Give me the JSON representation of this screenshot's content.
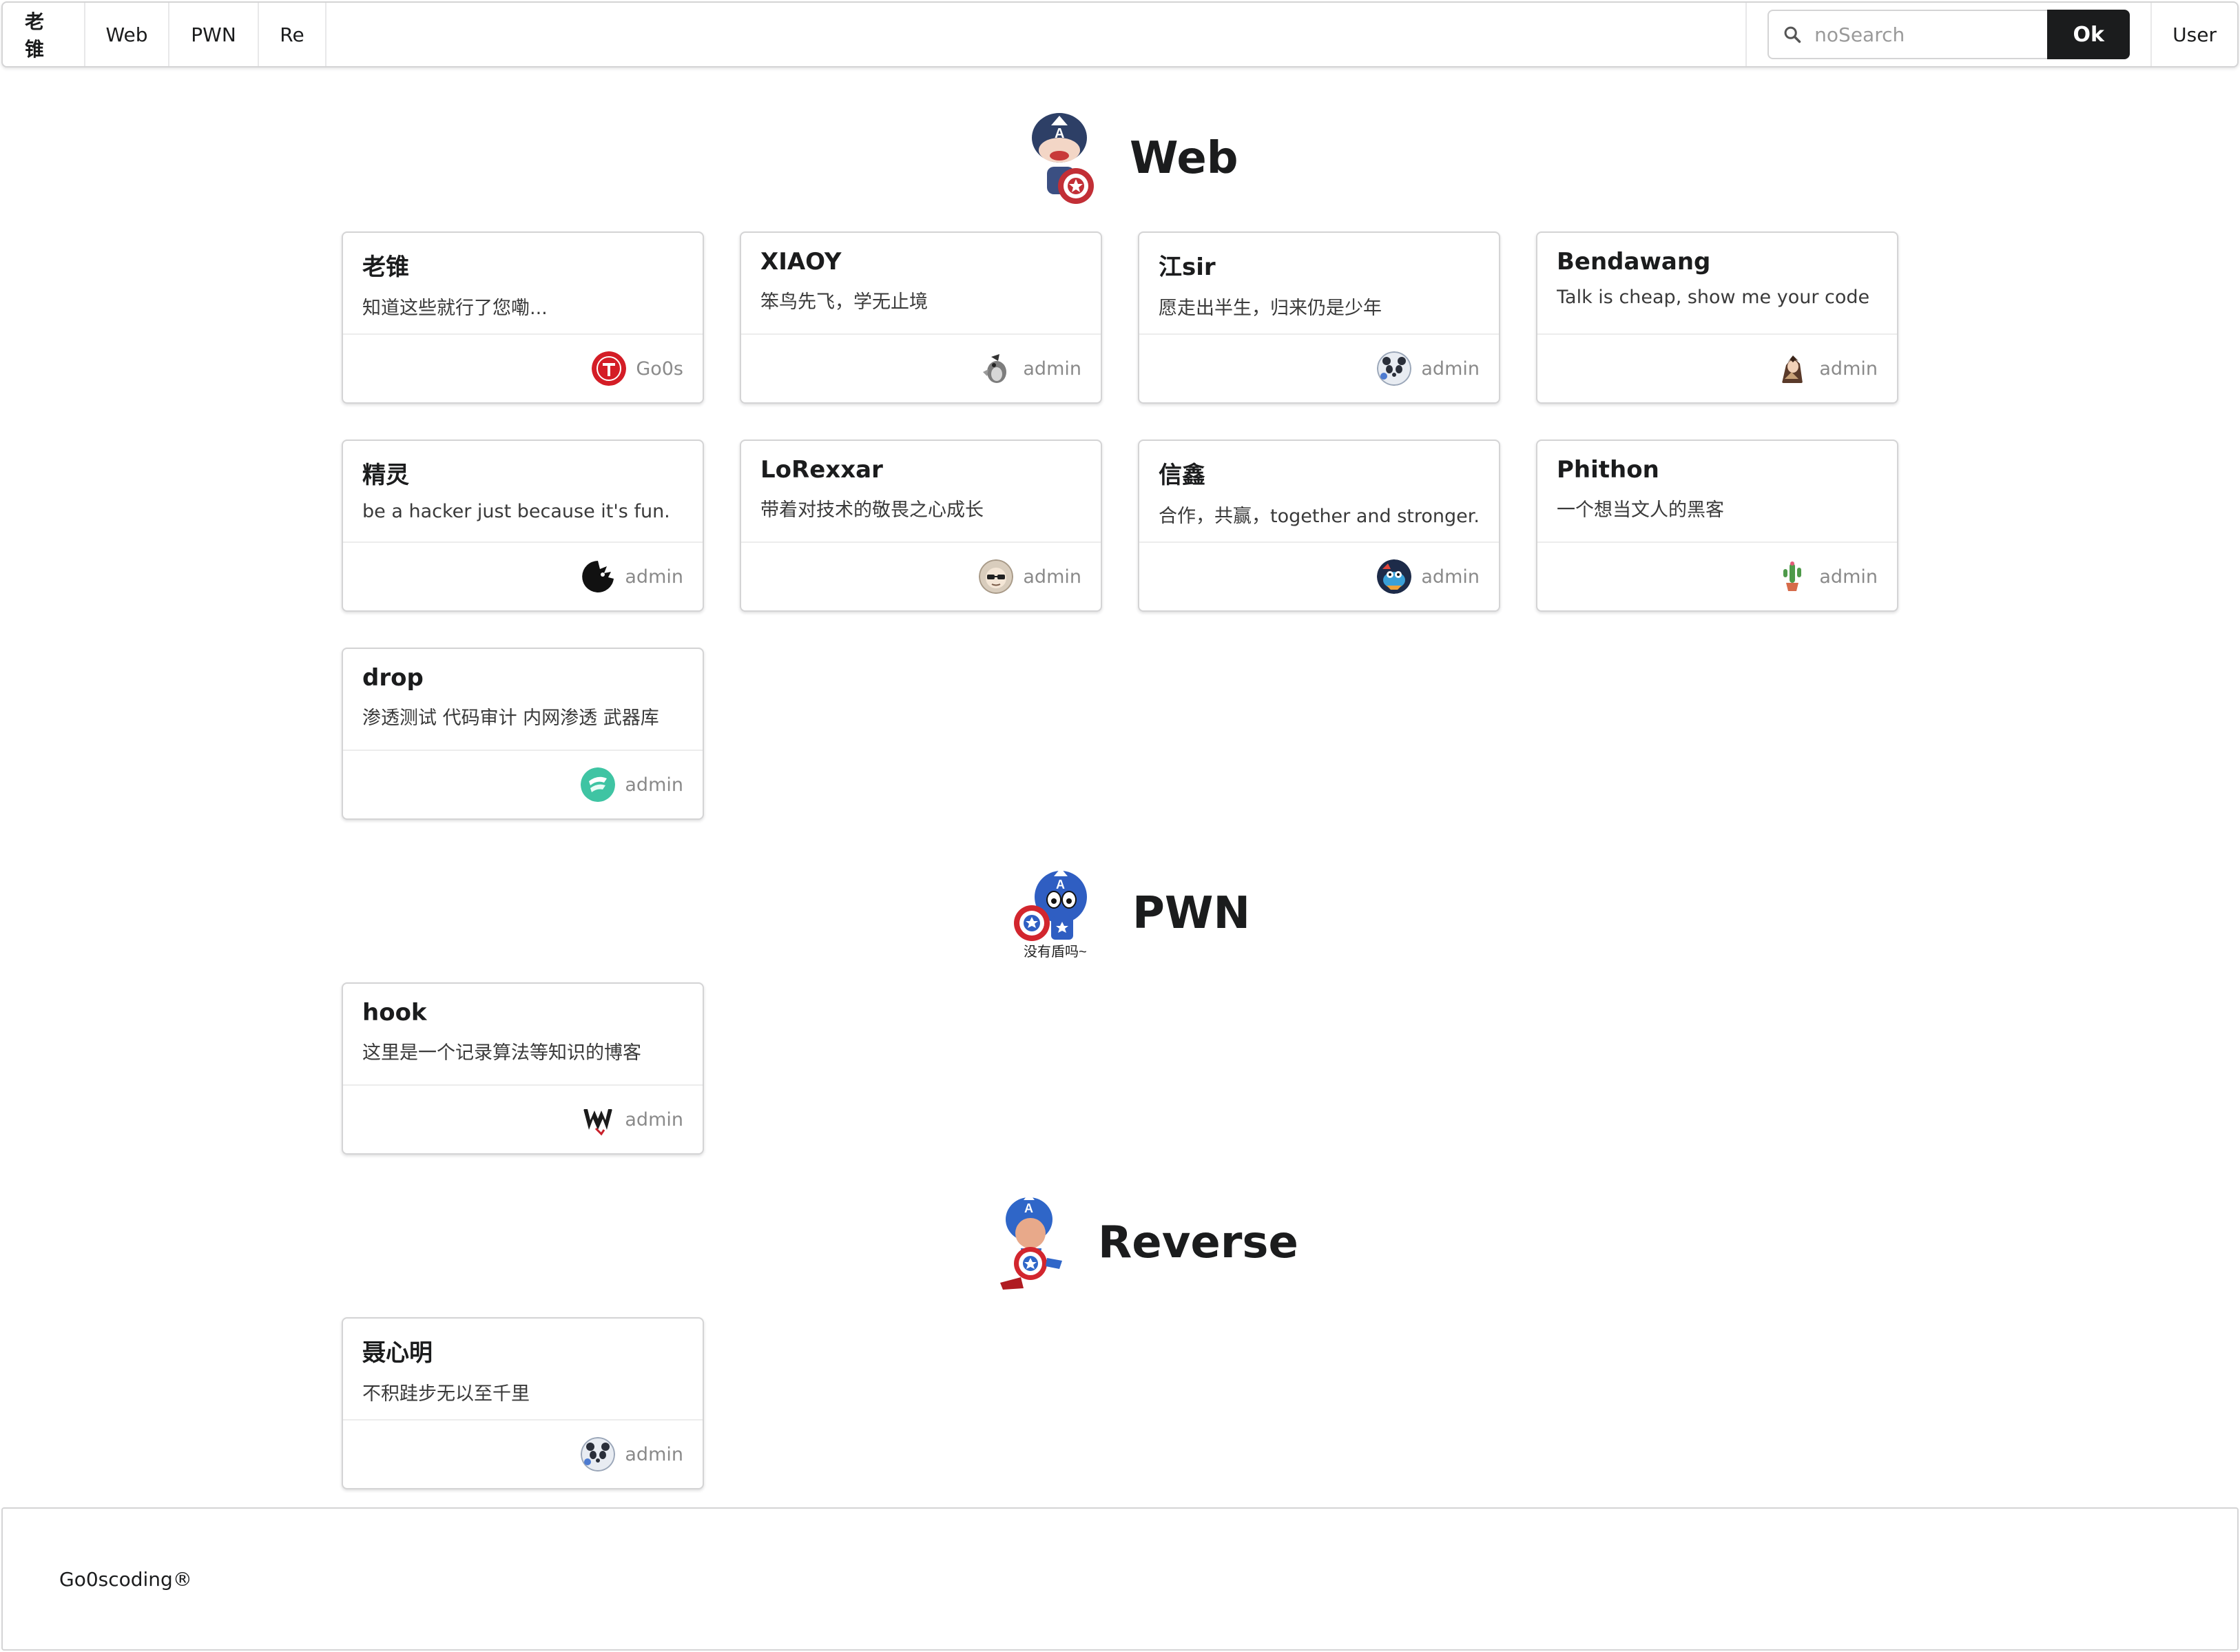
{
  "nav": {
    "brand": "老锥",
    "items": [
      "Web",
      "PWN",
      "Re"
    ],
    "search_placeholder": "noSearch",
    "ok_label": "Ok",
    "user_label": "User"
  },
  "sections": {
    "web": {
      "title": "Web",
      "cards": [
        {
          "name": "老锥",
          "desc": "知道这些就行了您嘞...",
          "author": "Go0s"
        },
        {
          "name": "XIAOY",
          "desc": "笨鸟先飞，学无止境",
          "author": "admin"
        },
        {
          "name": "江sir",
          "desc": "愿走出半生，归来仍是少年",
          "author": "admin"
        },
        {
          "name": "Bendawang",
          "desc": "Talk is cheap, show me your code",
          "author": "admin"
        },
        {
          "name": "精灵",
          "desc": "be a hacker just because it's fun.",
          "author": "admin"
        },
        {
          "name": "LoRexxar",
          "desc": "带着对技术的敬畏之心成长",
          "author": "admin"
        },
        {
          "name": "信鑫",
          "desc": "合作，共赢，together and stronger.",
          "author": "admin"
        },
        {
          "name": "Phithon",
          "desc": "一个想当文人的黑客",
          "author": "admin"
        },
        {
          "name": "drop",
          "desc": "渗透测试 代码审计 内网渗透 武器库",
          "author": "admin"
        }
      ]
    },
    "pwn": {
      "title": "PWN",
      "mascot_caption": "没有盾吗~",
      "cards": [
        {
          "name": "hook",
          "desc": "这里是一个记录算法等知识的博客",
          "author": "admin"
        }
      ]
    },
    "reverse": {
      "title": "Reverse",
      "cards": [
        {
          "name": "聂心明",
          "desc": "不积跬步无以至千里",
          "author": "admin"
        }
      ]
    }
  },
  "footer": {
    "copyright": "Go0scoding®"
  }
}
